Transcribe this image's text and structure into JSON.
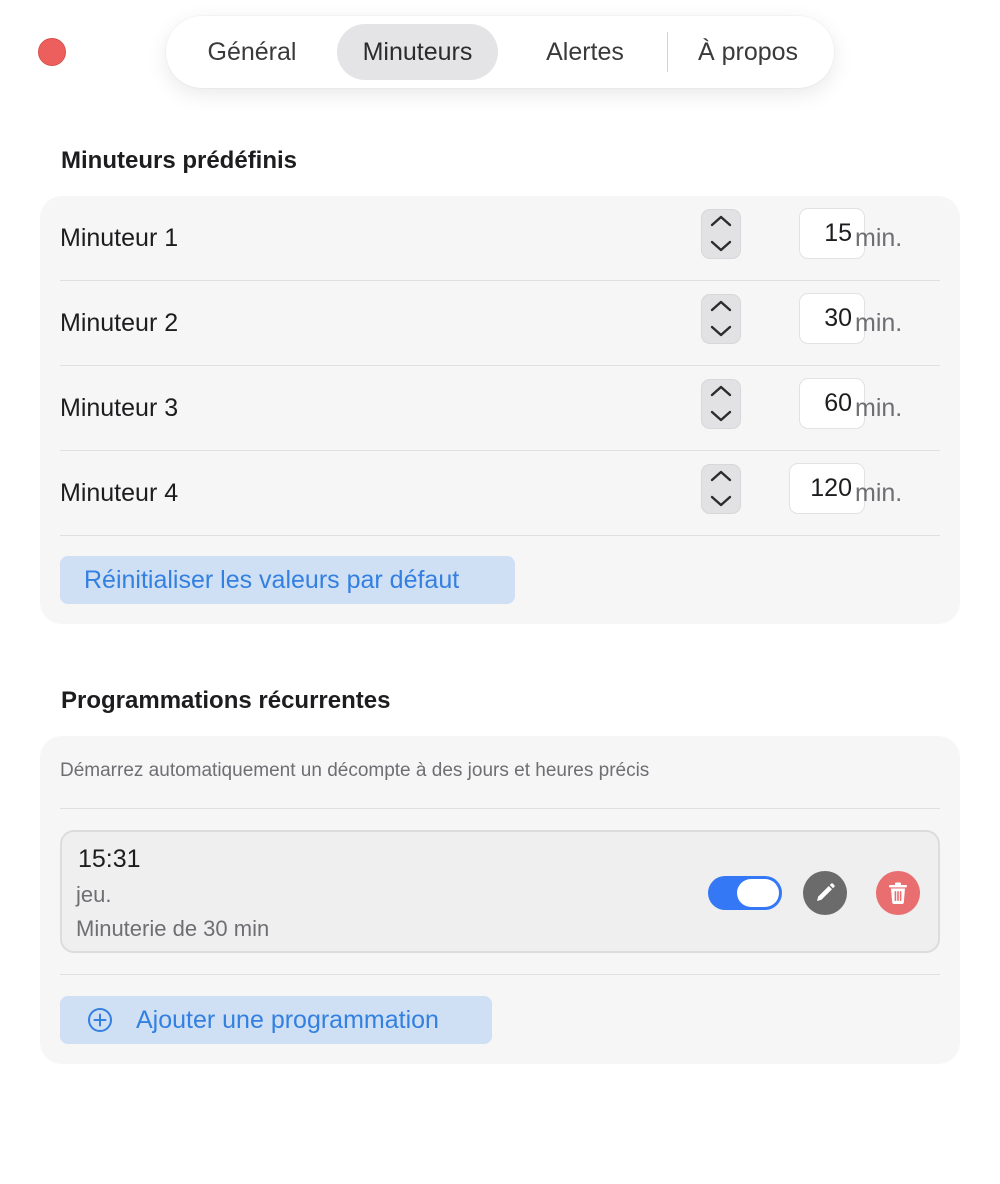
{
  "tabs": [
    {
      "label": "Général",
      "active": false
    },
    {
      "label": "Minuteurs",
      "active": true
    },
    {
      "label": "Alertes",
      "active": false
    },
    {
      "label": "À propos",
      "active": false
    }
  ],
  "presets": {
    "title": "Minuteurs prédéfinis",
    "rows": [
      {
        "label": "Minuteur 1",
        "value": "15",
        "unit": "min."
      },
      {
        "label": "Minuteur 2",
        "value": "30",
        "unit": "min."
      },
      {
        "label": "Minuteur 3",
        "value": "60",
        "unit": "min."
      },
      {
        "label": "Minuteur 4",
        "value": "120",
        "unit": "min."
      }
    ],
    "reset_label": "Réinitialiser les valeurs par défaut"
  },
  "schedules": {
    "title": "Programmations récurrentes",
    "description": "Démarrez automatiquement un décompte à des jours et heures précis",
    "items": [
      {
        "time": "15:31",
        "days": "jeu.",
        "detail": "Minuterie de 30 min",
        "enabled": true
      }
    ],
    "add_label": "Ajouter une programmation"
  },
  "icons": {
    "close": "close-icon",
    "stepper_up": "chevron-up-icon",
    "stepper_down": "chevron-down-icon",
    "edit": "pencil-icon",
    "delete": "trash-icon",
    "add": "plus-circle-icon"
  },
  "colors": {
    "accent": "#3478f6",
    "button_tint_bg": "#cfdff4",
    "button_tint_text": "#3380e0",
    "close": "#ec5f5c",
    "delete": "#e86e6f",
    "edit": "#6b6b6b"
  }
}
